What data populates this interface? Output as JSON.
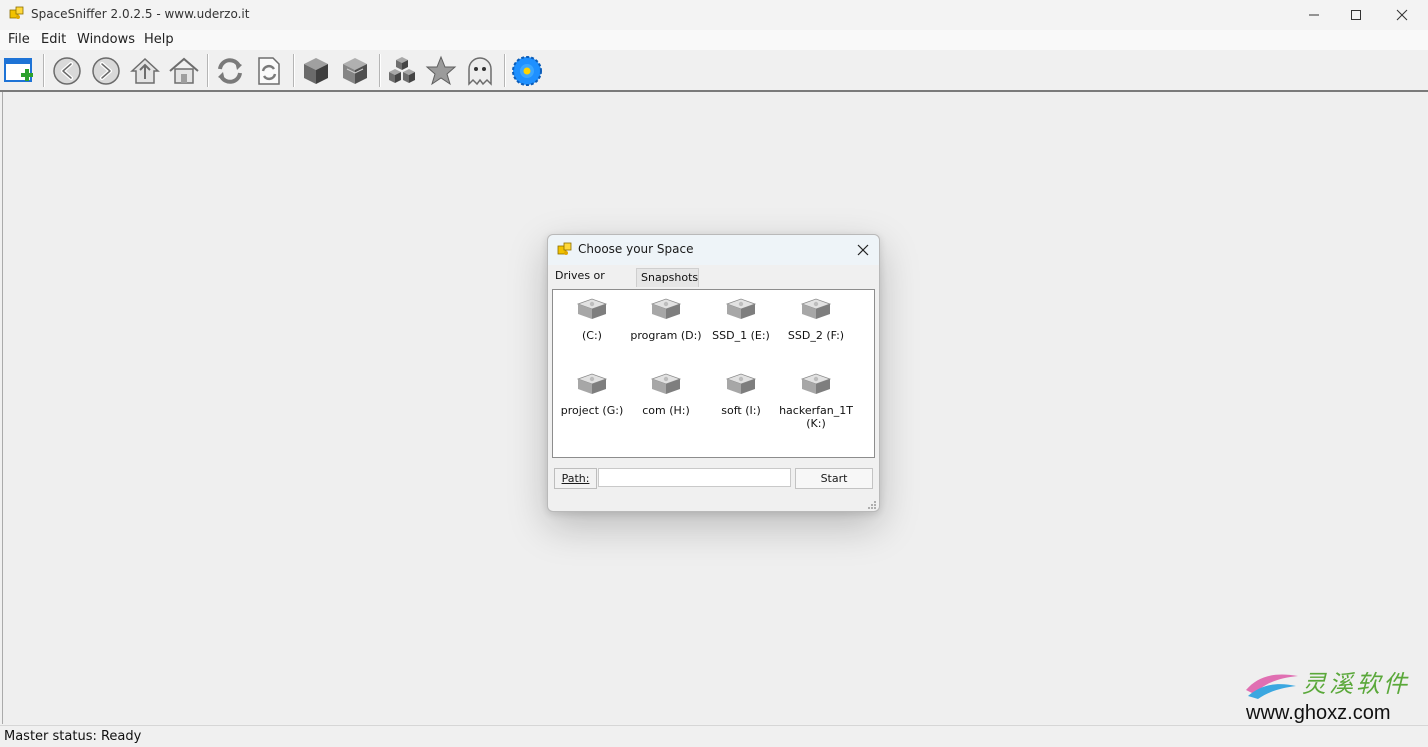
{
  "window": {
    "title": "SpaceSniffer 2.0.2.5 - www.uderzo.it",
    "app_icon": "puzzle-icon",
    "controls": [
      "minimize-icon",
      "maximize-icon",
      "close-icon"
    ]
  },
  "menu": {
    "items": [
      "File",
      "Edit",
      "Windows",
      "Help"
    ]
  },
  "toolbar": {
    "buttons": [
      {
        "name": "new-window-icon"
      },
      {
        "name": "back-arrow-icon"
      },
      {
        "name": "forward-arrow-icon"
      },
      {
        "name": "up-folder-icon"
      },
      {
        "name": "home-icon"
      },
      {
        "name": "refresh-icon"
      },
      {
        "name": "refresh-document-icon"
      },
      {
        "name": "cube-icon"
      },
      {
        "name": "cube-alt-icon"
      },
      {
        "name": "multi-cubes-icon"
      },
      {
        "name": "star-icon"
      },
      {
        "name": "ghost-icon"
      },
      {
        "name": "blue-flower-icon"
      }
    ]
  },
  "dialog": {
    "title": "Choose your Space",
    "icon": "puzzle-icon",
    "tabs": [
      "Drives or Paths",
      "Snapshots"
    ],
    "active_tab": "Drives or Paths",
    "drives": [
      {
        "label": "(C:)"
      },
      {
        "label": "program (D:)"
      },
      {
        "label": "SSD_1 (E:)"
      },
      {
        "label": "SSD_2 (F:)"
      },
      {
        "label": "project (G:)"
      },
      {
        "label": "com (H:)"
      },
      {
        "label": "soft (I:)"
      },
      {
        "label": "hackerfan_1T (K:)"
      }
    ],
    "path_label": "Path:",
    "path_value": "",
    "start_label": "Start"
  },
  "status": {
    "text": "Master status: Ready"
  },
  "watermark": {
    "chinese": "灵溪软件",
    "url": "www.ghoxz.com"
  },
  "colors": {
    "accent_blue": "#1e90ff",
    "drive_gray": "#9a9a9a",
    "watermark_green": "#5aa83a"
  }
}
